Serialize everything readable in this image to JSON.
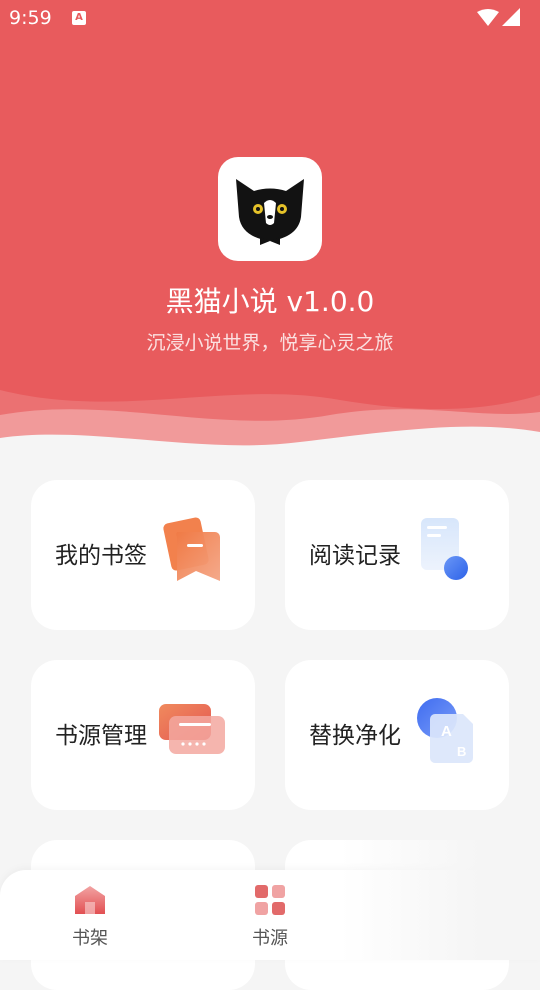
{
  "status_bar": {
    "time": "9:59",
    "app_icon_letter": "A"
  },
  "header": {
    "title": "黑猫小说 v1.0.0",
    "subtitle": "沉浸小说世界，悦享心灵之旅",
    "background_color": "#e85b5d"
  },
  "menu": {
    "cards": [
      {
        "label": "我的书签",
        "icon": "bookmark-icon"
      },
      {
        "label": "阅读记录",
        "icon": "reading-history-icon"
      },
      {
        "label": "书源管理",
        "icon": "source-manage-icon"
      },
      {
        "label": "替换净化",
        "icon": "replace-purify-icon"
      }
    ]
  },
  "bottom_nav": {
    "items": [
      {
        "label": "书架",
        "icon": "bookshelf-icon"
      },
      {
        "label": "书源",
        "icon": "book-source-icon"
      }
    ]
  }
}
